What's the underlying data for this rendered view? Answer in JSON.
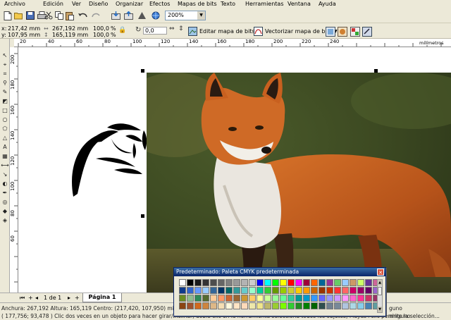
{
  "menu": [
    "Archivo",
    "Edición",
    "Ver",
    "Diseño",
    "Organizar",
    "Efectos",
    "Mapas de bits",
    "Texto",
    "Herramientas",
    "Ventana",
    "Ayuda"
  ],
  "toolbar": {
    "zoom_value": "200%",
    "icons": [
      "new-icon",
      "open-icon",
      "save-icon",
      "print-icon",
      "cut-icon",
      "copy-icon",
      "paste-icon",
      "undo-icon",
      "redo-icon",
      "import-icon",
      "export-icon",
      "app-launcher-icon",
      "corel-online-icon"
    ]
  },
  "propbar": {
    "x_label": "x:",
    "x_value": "217,42 mm",
    "y_label": "y:",
    "y_value": "107,95 mm",
    "w_value": "267,192 mm",
    "h_value": "165,119 mm",
    "scale_w": "100,0",
    "scale_h": "100,0",
    "percent": "%",
    "rotation": "0,0",
    "edit_bitmap": "Editar mapa de bits...",
    "trace_bitmap": "Vectorizar mapa de bits"
  },
  "rulers": {
    "h_ticks": [
      "20",
      "40",
      "60",
      "80",
      "100",
      "120",
      "140",
      "160",
      "180",
      "200",
      "220",
      "240"
    ],
    "h_unit": "milímetros",
    "v_ticks": [
      "200",
      "180",
      "160",
      "140",
      "120",
      "100",
      "80",
      "60"
    ]
  },
  "pagebar": {
    "first": "⏮",
    "prev": "◂",
    "count": "1 de 1",
    "next": "▸",
    "last": "⏭",
    "add": "+",
    "tab": "Página 1"
  },
  "status": {
    "line1": "Anchura: 267,192  Altura: 165,119  Centro: (217,420, 107,950)  milímetros",
    "line2": "( 177,756; 93,478 )       Clic dos veces en un objeto para hacer girar/inclinar; doble clic en la herramienta selecciona todos los objetos; Mayús+clic permite la selección...",
    "right1": "guno",
    "right2": "ninguno"
  },
  "palette": {
    "title": "Predeterminado: Paleta CMYK predeterminada",
    "colors": [
      "#ffffff",
      "#000000",
      "#1a1a1a",
      "#333333",
      "#4d4d4d",
      "#666666",
      "#808080",
      "#999999",
      "#b3b3b3",
      "#cccccc",
      "#0000ff",
      "#00ffff",
      "#00ff00",
      "#ffff00",
      "#ff0000",
      "#ff00ff",
      "#9e0039",
      "#ff6600",
      "#006699",
      "#993399",
      "#66cc66",
      "#99ccff",
      "#cc9966",
      "#ccff66",
      "#663399",
      "#cc6699",
      "#0f3b8c",
      "#3366cc",
      "#6699ff",
      "#99ccff",
      "#336699",
      "#003366",
      "#006666",
      "#339999",
      "#66cccc",
      "#99ffcc",
      "#00cc99",
      "#33cc33",
      "#669900",
      "#99cc00",
      "#cccc33",
      "#ffcc00",
      "#ff9900",
      "#cc6600",
      "#993300",
      "#cc3300",
      "#ff3333",
      "#ff6666",
      "#cc0066",
      "#990066",
      "#660066",
      "#9966cc",
      "#6b8e23",
      "#8fbc8f",
      "#2e8b57",
      "#556b2f",
      "#ffcc99",
      "#ff9966",
      "#cc6633",
      "#996633",
      "#cc9933",
      "#ffcc66",
      "#ffff99",
      "#ccff99",
      "#99ff99",
      "#66ff99",
      "#33cc99",
      "#009999",
      "#0099cc",
      "#3399ff",
      "#6666ff",
      "#9999ff",
      "#cc99ff",
      "#ff99ff",
      "#ff66cc",
      "#ff3399",
      "#cc3366",
      "#993366",
      "#8b4513",
      "#a0522d",
      "#d2691e",
      "#cd853f",
      "#deb887",
      "#f5deb3",
      "#fff8dc",
      "#ffe4c4",
      "#ffdab9",
      "#eee8aa",
      "#f0e68c",
      "#bdb76b",
      "#9acd32",
      "#7cfc00",
      "#32cd32",
      "#228b22",
      "#008000",
      "#006400",
      "#2f4f4f",
      "#708090",
      "#778899",
      "#b0c4de",
      "#add8e6",
      "#87ceeb",
      "#4682b4",
      "#5f9ea0"
    ]
  }
}
